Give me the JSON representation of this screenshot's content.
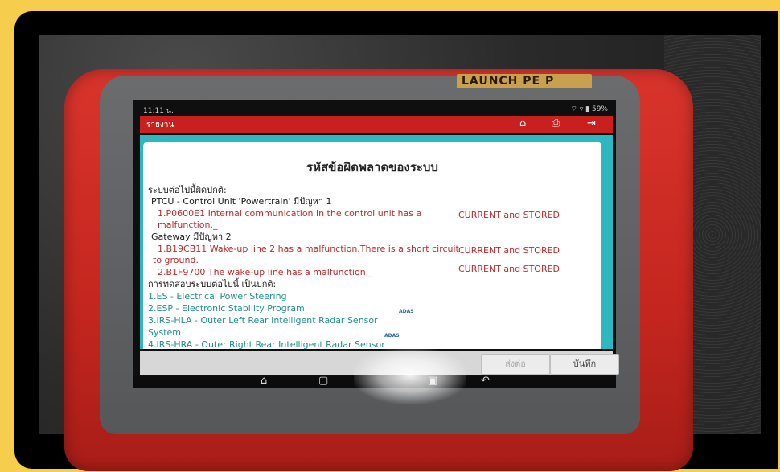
{
  "device": {
    "brand_label": "LAUNCH PE P",
    "status_time": "11:11 น.",
    "status_battery": "59%"
  },
  "header": {
    "title": "รายงาน"
  },
  "report": {
    "title": "รหัสข้อผิดพลาดของระบบ",
    "abnormal_heading": "ระบบต่อไปนี้ผิดปกติ:",
    "systems": [
      {
        "name": "PTCU - Control Unit 'Powertrain' มีปัญหา 1",
        "faults": [
          {
            "text_1": "1.P0600E1 Internal communication in the control unit has a",
            "text_2": "malfunction._",
            "status": "CURRENT and STORED"
          }
        ]
      },
      {
        "name": "Gateway มีปัญหา 2",
        "faults": [
          {
            "text_1": "1.B19CB11 Wake-up line 2 has a malfunction.There is a short circuit",
            "text_2": "to ground.",
            "status": "CURRENT and STORED"
          },
          {
            "text_1": "2.B1F9700 The wake-up line has a malfunction._",
            "status": "CURRENT and STORED"
          }
        ]
      }
    ],
    "normal_heading": "การทดสอบระบบต่อไปนี้ เป็นปกติ:",
    "normal_systems": [
      {
        "label": "1.ES - Electrical Power Steering"
      },
      {
        "label": "2.ESP - Electronic Stability Program"
      },
      {
        "label": "3.IRS-HLA - Outer Left Rear Intelligent Radar Sensor",
        "label_2": "System",
        "badge": "ADAS"
      },
      {
        "label": "4.IRS-HRA - Outer Right Rear Intelligent Radar Sensor",
        "badge": "ADAS"
      }
    ]
  },
  "buttons": {
    "send": "ส่งต่อ",
    "save": "บันทึก"
  },
  "icons": {
    "home": "home-icon",
    "print": "print-icon",
    "exit": "exit-icon",
    "nav_home": "nav-home-icon",
    "nav_recent": "nav-recent-icon",
    "nav_screenshot": "screenshot-icon",
    "nav_back": "back-icon"
  },
  "colors": {
    "header_red": "#c8201f",
    "content_teal": "#2db7c1",
    "fault_red": "#c0292b",
    "ok_teal": "#1e8f8a",
    "bumper_red": "#d8342c",
    "background_yellow": "#f6cd4c"
  }
}
